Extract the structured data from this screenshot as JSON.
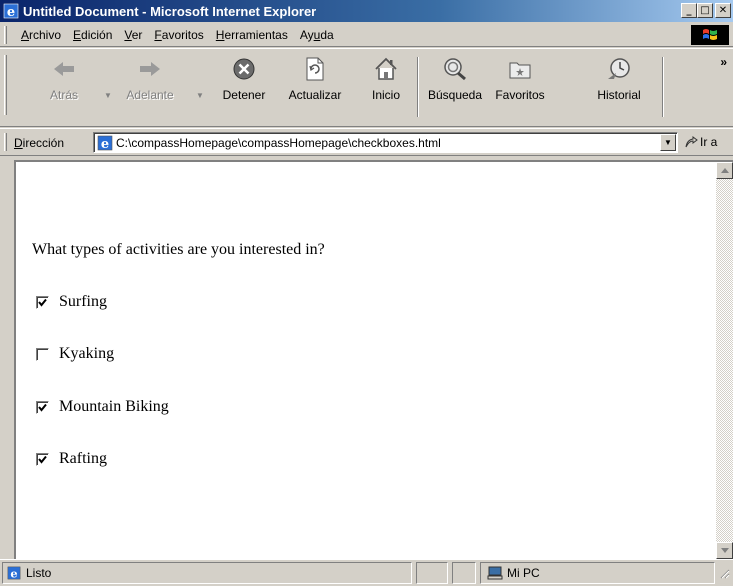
{
  "window": {
    "title": "Untitled Document - Microsoft Internet Explorer",
    "controls": {
      "minimize": "_",
      "maximize": "□",
      "close": "✕"
    }
  },
  "menu": {
    "items": [
      {
        "label": "Archivo",
        "ul": "A",
        "rest": "rchivo"
      },
      {
        "label": "Edición",
        "ul": "E",
        "rest": "dición"
      },
      {
        "label": "Ver",
        "ul": "V",
        "rest": "er"
      },
      {
        "label": "Favoritos",
        "ul": "F",
        "rest": "avoritos"
      },
      {
        "label": "Herramientas",
        "ul": "H",
        "rest": "erramientas"
      },
      {
        "label": "Ayuda",
        "pre": "Ay",
        "ul": "u",
        "rest": "da"
      }
    ]
  },
  "toolbar": {
    "back": "Atrás",
    "forward": "Adelante",
    "stop": "Detener",
    "refresh": "Actualizar",
    "home": "Inicio",
    "search": "Búsqueda",
    "favorites": "Favoritos",
    "history": "Historial",
    "more": "»"
  },
  "address": {
    "label_ul": "D",
    "label_rest": "irección",
    "value": "C:\\compassHomepage\\compassHomepage\\checkboxes.html",
    "go": "Ir a"
  },
  "page": {
    "question": "What types of activities are you interested in?",
    "options": [
      {
        "label": "Surfing",
        "checked": true
      },
      {
        "label": "Kyaking",
        "checked": false
      },
      {
        "label": "Mountain Biking",
        "checked": true
      },
      {
        "label": "Rafting",
        "checked": true
      }
    ]
  },
  "status": {
    "text": "Listo",
    "zone": "Mi PC"
  },
  "colors": {
    "titlebar_start": "#0a246a",
    "titlebar_end": "#a6caf0",
    "chrome": "#d4d0c8"
  }
}
